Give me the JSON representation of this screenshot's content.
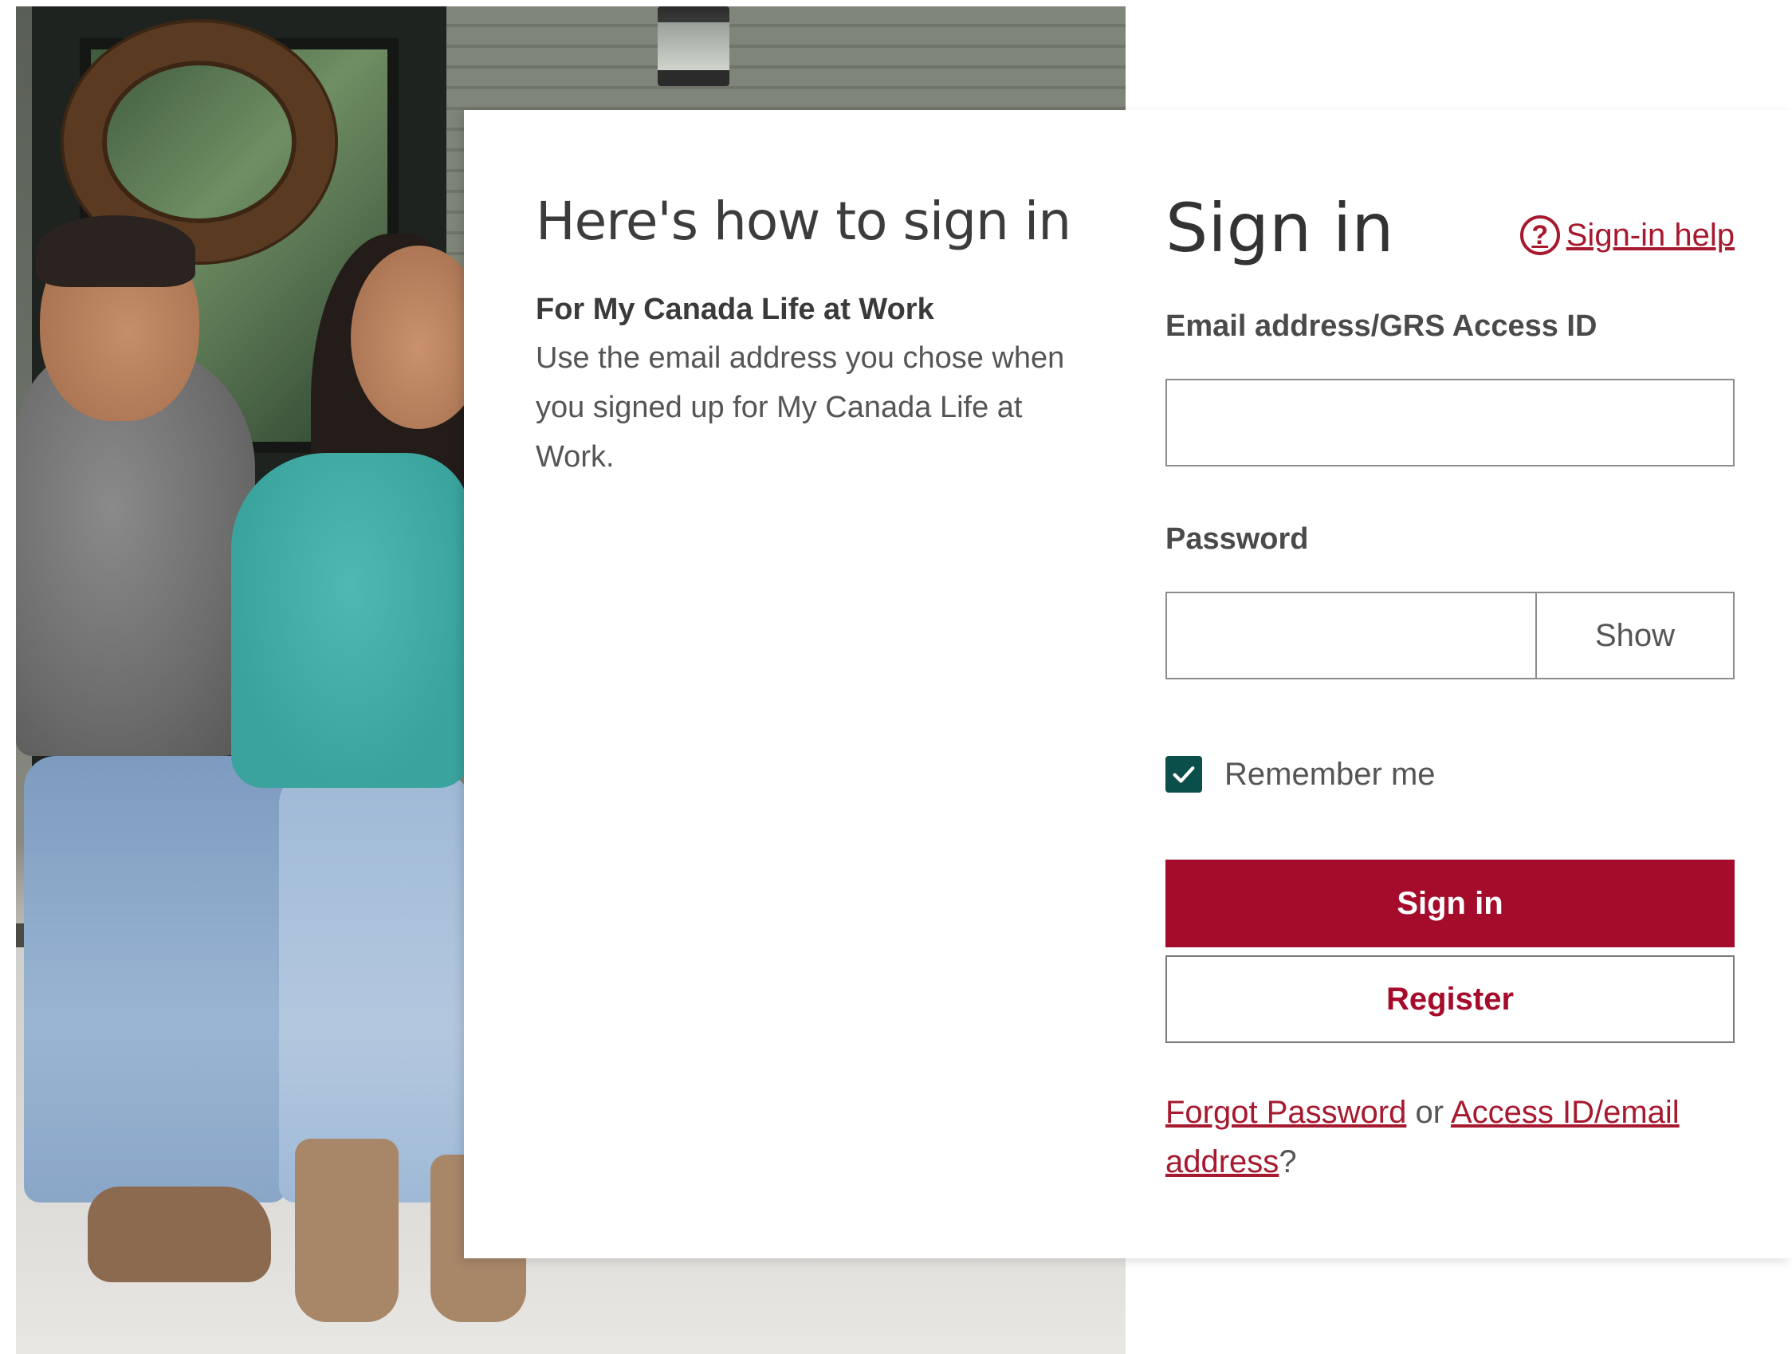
{
  "info": {
    "heading": "Here's how to sign in",
    "subheading": "For My Canada Life at Work",
    "description": "Use the email address you chose when you signed up for My Canada Life at Work."
  },
  "signin": {
    "title": "Sign in",
    "help_link": "Sign-in help",
    "help_icon_glyph": "?",
    "email_label": "Email address/GRS Access ID",
    "email_value": "",
    "password_label": "Password",
    "password_value": "",
    "show_button": "Show",
    "remember_label": "Remember me",
    "remember_checked": true,
    "submit_button": "Sign in",
    "register_button": "Register",
    "forgot_password_link": "Forgot Password",
    "or_text": " or ",
    "access_id_link": "Access ID/email address",
    "question_mark": "?"
  },
  "colors": {
    "brand_red": "#a50b2a",
    "checkbox_teal": "#0b4f4a"
  },
  "icons": {
    "help": "question-circle-icon",
    "checkmark": "checkmark-icon"
  }
}
